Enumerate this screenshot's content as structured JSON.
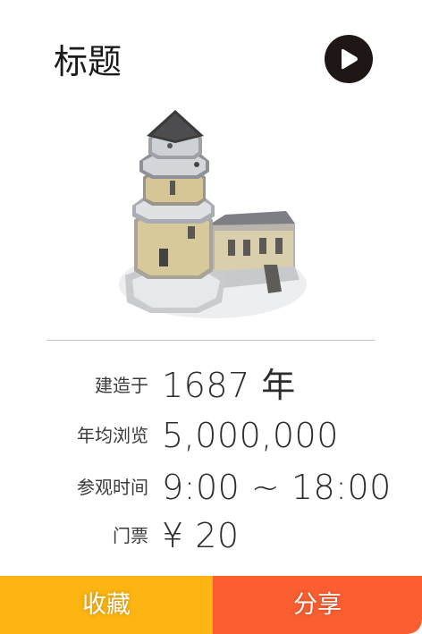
{
  "header": {
    "title": "标题",
    "play_icon": "play-circle-icon"
  },
  "illustration": {
    "subject": "historic-tower-building"
  },
  "info": [
    {
      "label": "建造于",
      "value": "1687 年"
    },
    {
      "label": "年均浏览",
      "value": "5,000,000"
    },
    {
      "label": "参观时间",
      "value": "9:00 ~ 18:00"
    },
    {
      "label": "门票",
      "value": "¥ 20"
    }
  ],
  "actions": {
    "collect_label": "收藏",
    "share_label": "分享"
  },
  "colors": {
    "collect": "#fdb511",
    "share": "#fb5f31",
    "play_bg": "#1f1616"
  }
}
